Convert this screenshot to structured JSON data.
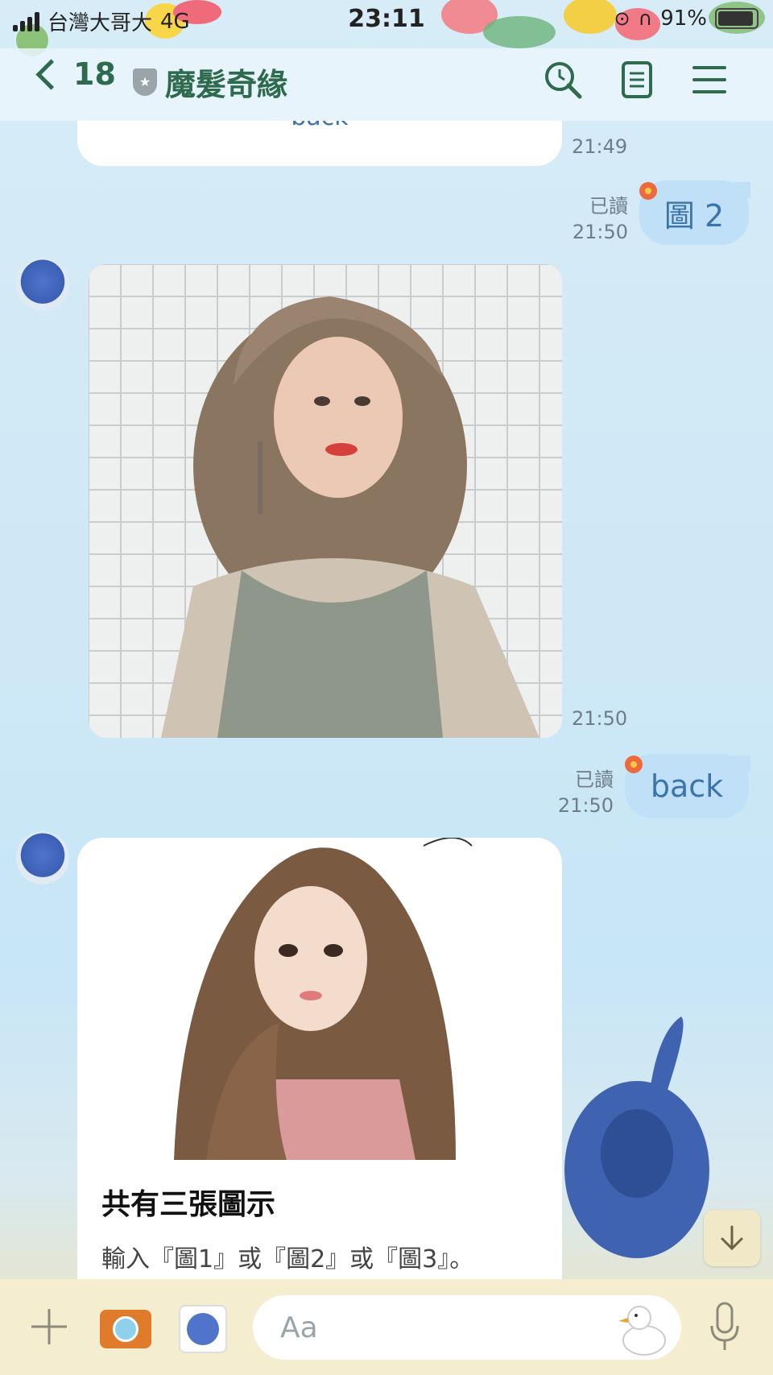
{
  "status": {
    "carrier": "台灣大哥大",
    "network": "4G",
    "time": "23:11",
    "battery": "91%"
  },
  "header": {
    "unread_count": "18",
    "title": "魔髮奇緣"
  },
  "messages": {
    "top_partial": {
      "text": "back",
      "time": "21:49"
    },
    "out1": {
      "text": "圖 2",
      "read": "已讀",
      "time": "21:50"
    },
    "photo1": {
      "time": "21:50"
    },
    "out2": {
      "text": "back",
      "read": "已讀",
      "time": "21:50"
    },
    "card": {
      "title": "共有三張圖示",
      "text": "輸入『圖1』或『圖2』或『圖3』。"
    }
  },
  "input": {
    "placeholder": "Aa"
  },
  "colors": {
    "header_text": "#2e6b4e",
    "outgoing_bubble": "#bfe0f6",
    "outgoing_text": "#3b74ac",
    "timestamp": "#6d7d8c"
  },
  "icons": [
    "back-chevron-icon",
    "shield-icon",
    "search-clock-icon",
    "notes-icon",
    "menu-icon",
    "plus-icon",
    "camera-icon",
    "sticker-icon",
    "duck-icon",
    "mic-icon",
    "arrow-down-icon",
    "hibiscus-icon"
  ]
}
